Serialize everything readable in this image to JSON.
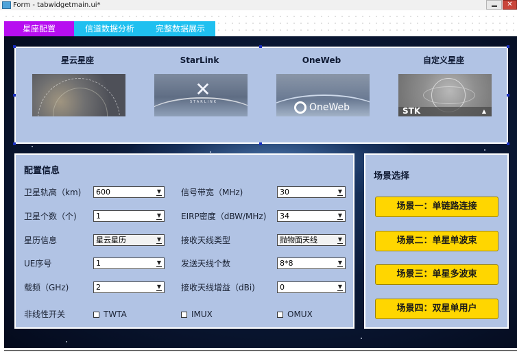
{
  "window": {
    "title": "Form - tabwidgetmain.ui*"
  },
  "tabs": [
    {
      "label": "星座配置",
      "active": true
    },
    {
      "label": "信道数据分析",
      "active": false
    },
    {
      "label": "完整数据展示",
      "active": false
    }
  ],
  "constellations": [
    {
      "title": "星云星座"
    },
    {
      "title": "StarLink",
      "image_text": "STARLINK"
    },
    {
      "title": "OneWeb",
      "image_text": "OneWeb"
    },
    {
      "title": "自定义星座",
      "image_text": "STK"
    }
  ],
  "config": {
    "title": "配置信息",
    "fields_left": [
      {
        "label": "卫星轨高（km)",
        "value": "600"
      },
      {
        "label": "卫星个数（个)",
        "value": "1"
      },
      {
        "label": "星历信息",
        "value": "星云星历"
      },
      {
        "label": "UE序号",
        "value": "1"
      },
      {
        "label": "载频（GHz)",
        "value": "2"
      }
    ],
    "fields_right": [
      {
        "label": "信号带宽（MHz)",
        "value": "30"
      },
      {
        "label": "EIRP密度（dBW/MHz)",
        "value": "34"
      },
      {
        "label": "接收天线类型",
        "value": "抛物面天线"
      },
      {
        "label": "发送天线个数",
        "value": "8*8"
      },
      {
        "label": "接收天线增益（dBi)",
        "value": "0"
      }
    ],
    "nonlinear": {
      "label": "非线性开关",
      "options": [
        {
          "label": "TWTA",
          "checked": false
        },
        {
          "label": "IMUX",
          "checked": false
        },
        {
          "label": "OMUX",
          "checked": false
        }
      ]
    }
  },
  "scenes": {
    "title": "场景选择",
    "buttons": [
      {
        "label": "场景一：单链路连接"
      },
      {
        "label": "场景二：单星单波束"
      },
      {
        "label": "场景三：单星多波束"
      },
      {
        "label": "场景四：双星单用户"
      }
    ]
  },
  "colors": {
    "tab_active": "#b70ef0",
    "tab_inactive": "#1fc0f0",
    "panel_bg": "#b1c3e4",
    "scene_button": "#ffd600",
    "selection_handle": "#1a2fbf"
  }
}
